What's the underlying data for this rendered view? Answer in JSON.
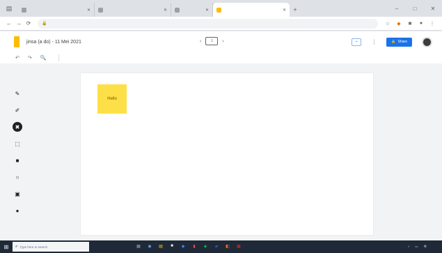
{
  "browser": {
    "tabs": [
      {
        "label": "",
        "active": false,
        "kind": "wide"
      },
      {
        "label": "",
        "active": false,
        "kind": "wide"
      },
      {
        "label": "",
        "active": false,
        "kind": "narrow"
      },
      {
        "label": "",
        "active": true,
        "kind": "wide"
      }
    ],
    "new_tab": "+",
    "window_controls": [
      "–",
      "□",
      "✕"
    ],
    "url": "",
    "nav": [
      "←",
      "→",
      "⟳"
    ]
  },
  "app": {
    "doc_title": "jinsa (a do) - 11 Mei 2021",
    "frame_counter": "1",
    "share_label": "Share",
    "menu_icon": "⋮"
  },
  "toolbar": {
    "undo": "↶",
    "redo": "↷",
    "zoom": "🔍",
    "set_background": "",
    "clear_frame": ""
  },
  "tools": [
    {
      "name": "pen-icon",
      "glyph": "✎"
    },
    {
      "name": "marker-icon",
      "glyph": "✐"
    },
    {
      "name": "eraser-icon",
      "glyph": "✖",
      "selected": true
    },
    {
      "name": "select-icon",
      "glyph": "⬚"
    },
    {
      "name": "sticky-note-icon",
      "glyph": "■"
    },
    {
      "name": "circle-shape-icon",
      "glyph": "○"
    },
    {
      "name": "image-icon",
      "glyph": "▣"
    },
    {
      "name": "laser-icon",
      "glyph": "●"
    }
  ],
  "canvas": {
    "sticky_note_text": "Hello"
  },
  "watermark": {
    "line1": "",
    "line2": ""
  },
  "taskbar": {
    "search_placeholder": "Type here to search",
    "apps": [
      "▦",
      "◉",
      "▤",
      "■",
      "◆",
      "▮",
      "◈",
      "▰",
      "◧",
      "▩"
    ],
    "tray": [
      "^",
      "▭",
      "⌘",
      "",
      ""
    ]
  }
}
